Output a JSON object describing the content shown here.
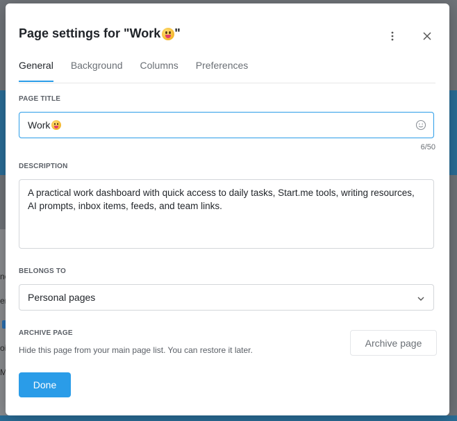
{
  "background": {
    "fragments": [
      "ne",
      "er",
      "oi",
      "M"
    ]
  },
  "dialog": {
    "title_prefix": "Page settings for \"Work",
    "title_suffix": " \"",
    "title_emoji": "grinning-face-with-tongue-icon"
  },
  "tabs": [
    {
      "label": "General",
      "active": true
    },
    {
      "label": "Background",
      "active": false
    },
    {
      "label": "Columns",
      "active": false
    },
    {
      "label": "Preferences",
      "active": false
    }
  ],
  "page_title": {
    "label": "PAGE TITLE",
    "value": "Work",
    "emoji": "grinning-face-with-tongue-icon",
    "counter": "6/50"
  },
  "description": {
    "label": "DESCRIPTION",
    "value": "A practical work dashboard with quick access to daily tasks, Start.me tools, writing resources, AI prompts, inbox items, feeds, and team links."
  },
  "belongs_to": {
    "label": "BELONGS TO",
    "value": "Personal pages"
  },
  "archive": {
    "label": "ARCHIVE PAGE",
    "description": "Hide this page from your main page list. You can restore it later.",
    "button": "Archive page"
  },
  "done_button": "Done",
  "colors": {
    "accent": "#2a9ce8",
    "background_app": "#2a6d97"
  }
}
